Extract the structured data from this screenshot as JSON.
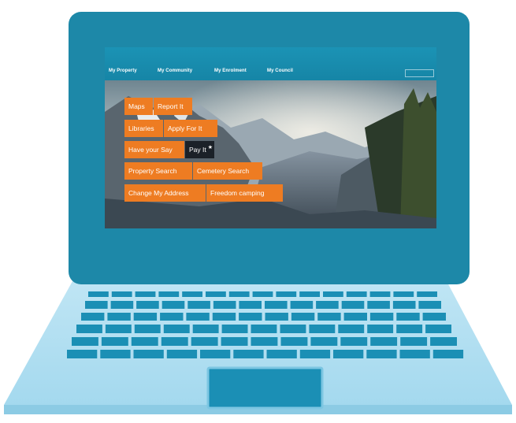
{
  "nav": {
    "items": [
      "My Property",
      "My Community",
      "My Enrolment",
      "My Council"
    ]
  },
  "tiles": {
    "row1": [
      "Maps",
      "Report It"
    ],
    "row2": [
      "Libraries",
      "Apply For It"
    ],
    "row3": [
      "Have your Say",
      "Pay It"
    ],
    "row4": [
      "Property Search",
      "Cemetery Search"
    ],
    "row5": [
      "Change My Address",
      "Freedom camping"
    ]
  },
  "colors": {
    "lid": "#1d88a8",
    "base": "#a9dcef",
    "tile": "#ee7c22",
    "tile_dark": "#1b2128",
    "key": "#1b8fb5"
  }
}
